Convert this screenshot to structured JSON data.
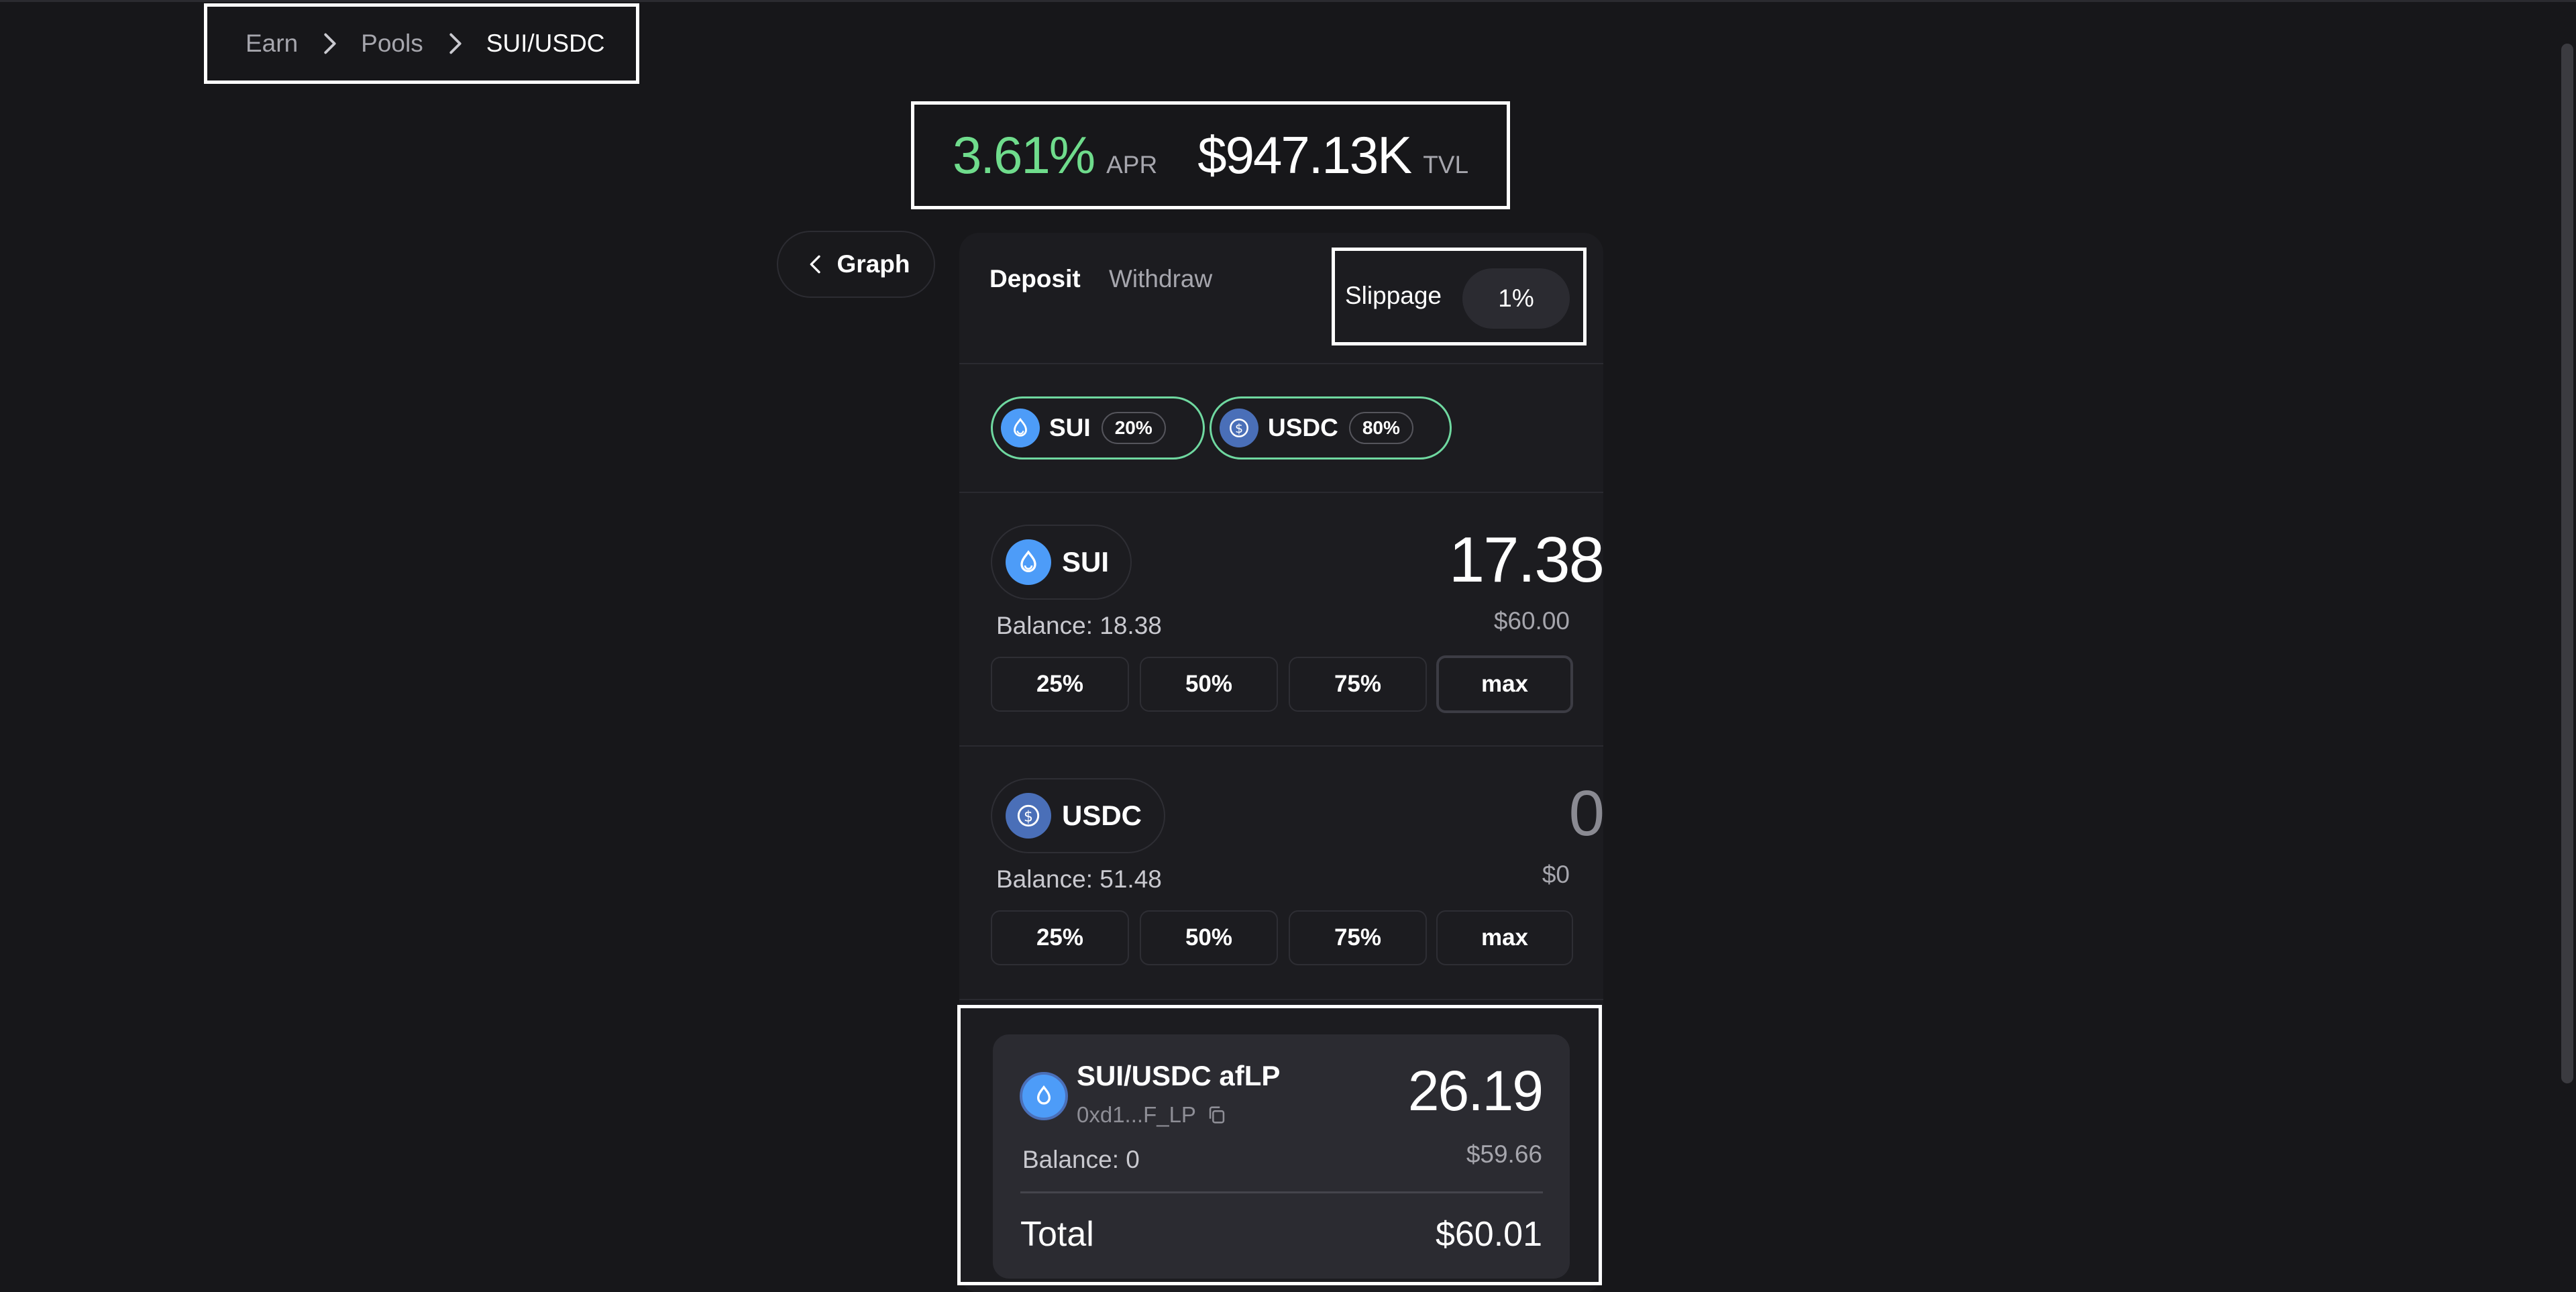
{
  "breadcrumb": {
    "items": [
      "Earn",
      "Pools",
      "SUI/USDC"
    ]
  },
  "stats": {
    "apr_value": "3.61%",
    "apr_label": "APR",
    "tvl_value": "$947.13K",
    "tvl_label": "TVL"
  },
  "graph_button": {
    "label": "Graph"
  },
  "tabs": {
    "deposit": "Deposit",
    "withdraw": "Withdraw",
    "active": "Deposit"
  },
  "slippage": {
    "label": "Slippage",
    "value": "1%"
  },
  "chips": [
    {
      "token": "SUI",
      "weight": "20%"
    },
    {
      "token": "USDC",
      "weight": "80%"
    }
  ],
  "assets": [
    {
      "token": "SUI",
      "amount": "17.38",
      "usd": "$60.00",
      "balance_label": "Balance:",
      "balance": "18.38",
      "buttons": [
        "25%",
        "50%",
        "75%",
        "max"
      ]
    },
    {
      "token": "USDC",
      "amount": "0",
      "usd": "$0",
      "balance_label": "Balance:",
      "balance": "51.48",
      "buttons": [
        "25%",
        "50%",
        "75%",
        "max"
      ]
    }
  ],
  "lp": {
    "name": "SUI/USDC afLP",
    "address": "0xd1...F_LP",
    "amount": "26.19",
    "usd": "$59.66",
    "balance_label": "Balance:",
    "balance": "0",
    "total_label": "Total",
    "total_value": "$60.01"
  },
  "colors": {
    "background": "#17171a",
    "card": "#1c1c20",
    "apr_green": "#6fdc8c",
    "chip_border": "#6fd8a0",
    "sui_blue": "#4d9cf8",
    "usdc_blue": "#4a6fb8"
  },
  "icons": {
    "chevron_right": "chevron-right-icon",
    "chevron_left": "chevron-left-icon",
    "sui": "sui-token-icon",
    "usdc": "usdc-token-icon",
    "lp": "lp-token-icon",
    "copy": "copy-icon"
  }
}
